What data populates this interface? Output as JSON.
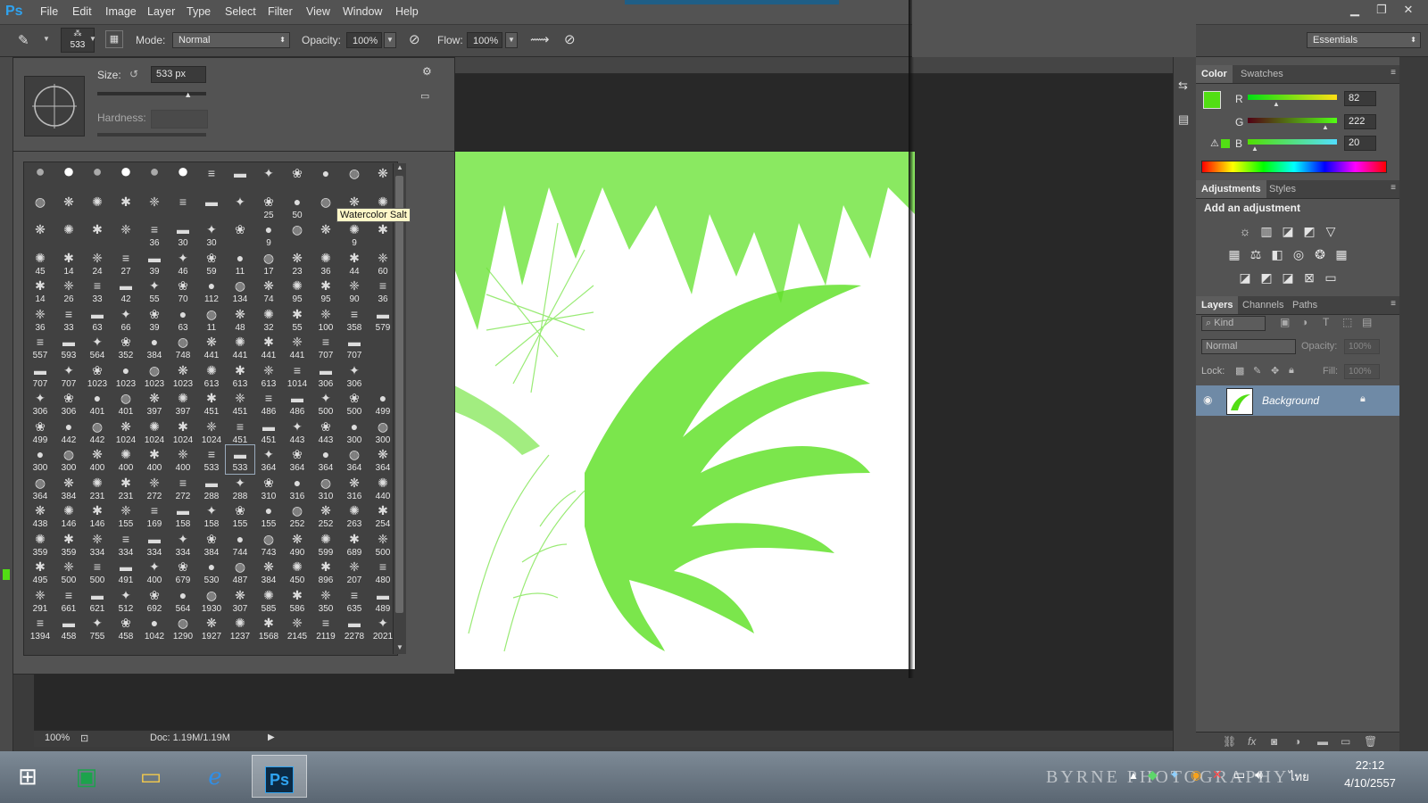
{
  "app": {
    "logo": "Ps"
  },
  "menu": [
    "File",
    "Edit",
    "Image",
    "Layer",
    "Type",
    "Select",
    "Filter",
    "View",
    "Window",
    "Help"
  ],
  "window_buttons": [
    "minimize",
    "restore",
    "close"
  ],
  "options": {
    "brush_size_badge": "533",
    "mode_label": "Mode:",
    "mode_value": "Normal",
    "opacity_label": "Opacity:",
    "opacity_value": "100%",
    "flow_label": "Flow:",
    "flow_value": "100%",
    "workspace": "Essentials"
  },
  "brush_panel": {
    "size_label": "Size:",
    "size_value": "533 px",
    "hardness_label": "Hardness:",
    "size_slider_fraction": 0.83
  },
  "tooltip": "Watercolor Salt",
  "brush_rows": [
    [
      "",
      "",
      "",
      "",
      "",
      "",
      "",
      "",
      "",
      "",
      "",
      "",
      ""
    ],
    [
      "",
      "",
      "",
      "",
      "",
      "",
      "",
      "",
      "25",
      "50",
      "",
      "",
      ""
    ],
    [
      "",
      "",
      "",
      "",
      "36",
      "30",
      "30",
      "",
      "9",
      "",
      "",
      "9",
      ""
    ],
    [
      "45",
      "14",
      "24",
      "27",
      "39",
      "46",
      "59",
      "11",
      "17",
      "23",
      "36",
      "44",
      "60"
    ],
    [
      "14",
      "26",
      "33",
      "42",
      "55",
      "70",
      "112",
      "134",
      "74",
      "95",
      "95",
      "90",
      "36"
    ],
    [
      "36",
      "33",
      "63",
      "66",
      "39",
      "63",
      "11",
      "48",
      "32",
      "55",
      "100",
      "358",
      "579"
    ],
    [
      "557",
      "593",
      "564",
      "352",
      "384",
      "748",
      "441",
      "441",
      "441",
      "441",
      "707",
      "707"
    ],
    [
      "707",
      "707",
      "1023",
      "1023",
      "1023",
      "1023",
      "613",
      "613",
      "613",
      "1014",
      "306",
      "306"
    ],
    [
      "306",
      "306",
      "401",
      "401",
      "397",
      "397",
      "451",
      "451",
      "486",
      "486",
      "500",
      "500",
      "499"
    ],
    [
      "499",
      "442",
      "442",
      "1024",
      "1024",
      "1024",
      "1024",
      "451",
      "451",
      "443",
      "443",
      "300",
      "300"
    ],
    [
      "300",
      "300",
      "400",
      "400",
      "400",
      "400",
      "533",
      "533",
      "364",
      "364",
      "364",
      "364",
      "364"
    ],
    [
      "364",
      "384",
      "231",
      "231",
      "272",
      "272",
      "288",
      "288",
      "310",
      "316",
      "310",
      "316",
      "440"
    ],
    [
      "438",
      "146",
      "146",
      "155",
      "169",
      "158",
      "158",
      "155",
      "155",
      "252",
      "252",
      "263",
      "254"
    ],
    [
      "359",
      "359",
      "334",
      "334",
      "334",
      "334",
      "384",
      "744",
      "743",
      "490",
      "599",
      "689",
      "500"
    ],
    [
      "495",
      "500",
      "500",
      "491",
      "400",
      "679",
      "530",
      "487",
      "384",
      "450",
      "896",
      "207",
      "480"
    ],
    [
      "291",
      "661",
      "621",
      "512",
      "692",
      "564",
      "1930",
      "307",
      "585",
      "586",
      "350",
      "635",
      "489"
    ],
    [
      "1394",
      "458",
      "755",
      "458",
      "1042",
      "1290",
      "1927",
      "1237",
      "1568",
      "2145",
      "2119",
      "2278",
      "2021"
    ]
  ],
  "color_panel": {
    "tabs": [
      "Color",
      "Swatches"
    ],
    "r_label": "R",
    "g_label": "G",
    "b_label": "B",
    "r": "82",
    "g": "222",
    "b": "20",
    "r_frac": 0.32,
    "g_frac": 0.87,
    "b_frac": 0.08,
    "fg_color": "#52de14"
  },
  "adjustments": {
    "tabs": [
      "Adjustments",
      "Styles"
    ],
    "title": "Add an adjustment"
  },
  "layers": {
    "tabs": [
      "Layers",
      "Channels",
      "Paths"
    ],
    "kind": "Kind",
    "blend": "Normal",
    "opacity_label": "Opacity:",
    "opacity_value": "100%",
    "lock_label": "Lock:",
    "fill_label": "Fill:",
    "fill_value": "100%",
    "layer_name": "Background"
  },
  "status": {
    "zoom": "100%",
    "doc": "Doc: 1.19M/1.19M"
  },
  "taskbar": {
    "apps": [
      "windows-logo",
      "store",
      "file-explorer",
      "internet-explorer",
      "photoshop"
    ],
    "ps_label": "Ps",
    "watermark": "BYRNE  PHOTOGRAPHY",
    "lang": "ไทย",
    "time": "22:12",
    "date": "4/10/2557"
  },
  "colors": {
    "accent_green": "#52de14",
    "ps_blue": "#2fa3f0"
  }
}
